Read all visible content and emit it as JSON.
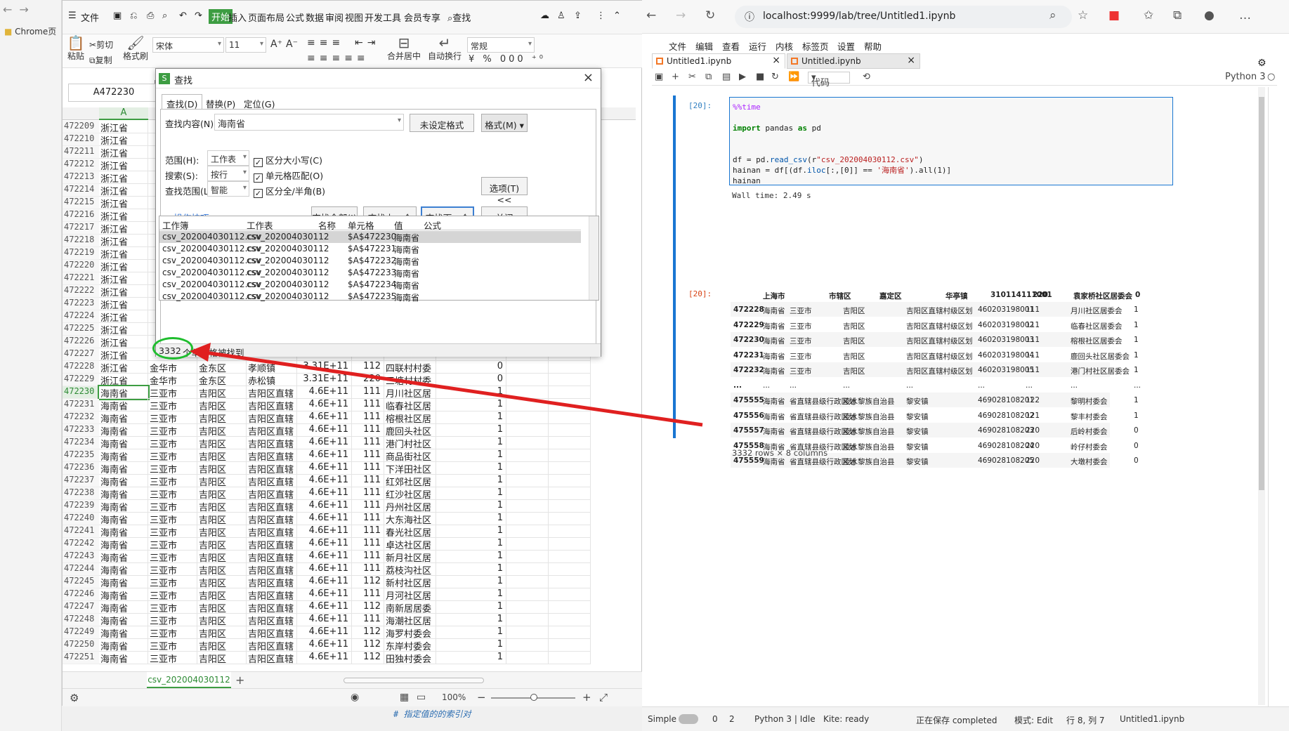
{
  "bg_chrome": {
    "bookmark": "Chrome页"
  },
  "wps": {
    "menu": [
      "文件",
      "开始",
      "插入",
      "页面布局",
      "公式",
      "数据",
      "审阅",
      "视图",
      "开发工具",
      "会员专享"
    ],
    "search": "查找",
    "ribbon": {
      "paste": "粘贴",
      "cut": "剪切",
      "copy": "复制",
      "format_painter": "格式刷",
      "font": "宋体",
      "size": "11",
      "number_format": "常规",
      "merge": "合并居中",
      "wrap": "自动换行"
    },
    "namebox": "A472230",
    "col_a": "A",
    "rows": [
      {
        "n": "472209",
        "a": "浙江省"
      },
      {
        "n": "472210",
        "a": "浙江省"
      },
      {
        "n": "472211",
        "a": "浙江省"
      },
      {
        "n": "472212",
        "a": "浙江省"
      },
      {
        "n": "472213",
        "a": "浙江省"
      },
      {
        "n": "472214",
        "a": "浙江省"
      },
      {
        "n": "472215",
        "a": "浙江省"
      },
      {
        "n": "472216",
        "a": "浙江省"
      },
      {
        "n": "472217",
        "a": "浙江省"
      },
      {
        "n": "472218",
        "a": "浙江省"
      },
      {
        "n": "472219",
        "a": "浙江省"
      },
      {
        "n": "472220",
        "a": "浙江省"
      },
      {
        "n": "472221",
        "a": "浙江省"
      },
      {
        "n": "472222",
        "a": "浙江省"
      },
      {
        "n": "472223",
        "a": "浙江省"
      },
      {
        "n": "472224",
        "a": "浙江省"
      },
      {
        "n": "472225",
        "a": "浙江省"
      },
      {
        "n": "472226",
        "a": "浙江省"
      },
      {
        "n": "472227",
        "a": "浙江省"
      },
      {
        "n": "472228",
        "a": "浙江省",
        "b": "金华市",
        "c": "金东区",
        "d": "孝顺镇",
        "e": "3.31E+11",
        "f": "112",
        "g": "四联村村委",
        "h": "0"
      },
      {
        "n": "472229",
        "a": "浙江省",
        "b": "金华市",
        "c": "金东区",
        "d": "赤松镇",
        "e": "3.31E+11",
        "f": "220",
        "g": "三塘村村委",
        "h": "0"
      },
      {
        "n": "472230",
        "a": "海南省",
        "b": "三亚市",
        "c": "吉阳区",
        "d": "吉阳区直辖",
        "e": "4.6E+11",
        "f": "111",
        "g": "月川社区居",
        "h": "1"
      },
      {
        "n": "472231",
        "a": "海南省",
        "b": "三亚市",
        "c": "吉阳区",
        "d": "吉阳区直辖",
        "e": "4.6E+11",
        "f": "111",
        "g": "临春社区居",
        "h": "1"
      },
      {
        "n": "472232",
        "a": "海南省",
        "b": "三亚市",
        "c": "吉阳区",
        "d": "吉阳区直辖",
        "e": "4.6E+11",
        "f": "111",
        "g": "榕根社区居",
        "h": "1"
      },
      {
        "n": "472233",
        "a": "海南省",
        "b": "三亚市",
        "c": "吉阳区",
        "d": "吉阳区直辖",
        "e": "4.6E+11",
        "f": "111",
        "g": "鹿回头社区",
        "h": "1"
      },
      {
        "n": "472234",
        "a": "海南省",
        "b": "三亚市",
        "c": "吉阳区",
        "d": "吉阳区直辖",
        "e": "4.6E+11",
        "f": "111",
        "g": "港门村社区",
        "h": "1"
      },
      {
        "n": "472235",
        "a": "海南省",
        "b": "三亚市",
        "c": "吉阳区",
        "d": "吉阳区直辖",
        "e": "4.6E+11",
        "f": "111",
        "g": "商品街社区",
        "h": "1"
      },
      {
        "n": "472236",
        "a": "海南省",
        "b": "三亚市",
        "c": "吉阳区",
        "d": "吉阳区直辖",
        "e": "4.6E+11",
        "f": "111",
        "g": "下洋田社区",
        "h": "1"
      },
      {
        "n": "472237",
        "a": "海南省",
        "b": "三亚市",
        "c": "吉阳区",
        "d": "吉阳区直辖",
        "e": "4.6E+11",
        "f": "111",
        "g": "红郊社区居",
        "h": "1"
      },
      {
        "n": "472238",
        "a": "海南省",
        "b": "三亚市",
        "c": "吉阳区",
        "d": "吉阳区直辖",
        "e": "4.6E+11",
        "f": "111",
        "g": "红沙社区居",
        "h": "1"
      },
      {
        "n": "472239",
        "a": "海南省",
        "b": "三亚市",
        "c": "吉阳区",
        "d": "吉阳区直辖",
        "e": "4.6E+11",
        "f": "111",
        "g": "丹州社区居",
        "h": "1"
      },
      {
        "n": "472240",
        "a": "海南省",
        "b": "三亚市",
        "c": "吉阳区",
        "d": "吉阳区直辖",
        "e": "4.6E+11",
        "f": "111",
        "g": "大东海社区",
        "h": "1"
      },
      {
        "n": "472241",
        "a": "海南省",
        "b": "三亚市",
        "c": "吉阳区",
        "d": "吉阳区直辖",
        "e": "4.6E+11",
        "f": "111",
        "g": "春光社区居",
        "h": "1"
      },
      {
        "n": "472242",
        "a": "海南省",
        "b": "三亚市",
        "c": "吉阳区",
        "d": "吉阳区直辖",
        "e": "4.6E+11",
        "f": "111",
        "g": "卓达社区居",
        "h": "1"
      },
      {
        "n": "472243",
        "a": "海南省",
        "b": "三亚市",
        "c": "吉阳区",
        "d": "吉阳区直辖",
        "e": "4.6E+11",
        "f": "111",
        "g": "新月社区居",
        "h": "1"
      },
      {
        "n": "472244",
        "a": "海南省",
        "b": "三亚市",
        "c": "吉阳区",
        "d": "吉阳区直辖",
        "e": "4.6E+11",
        "f": "111",
        "g": "荔枝沟社区",
        "h": "1"
      },
      {
        "n": "472245",
        "a": "海南省",
        "b": "三亚市",
        "c": "吉阳区",
        "d": "吉阳区直辖",
        "e": "4.6E+11",
        "f": "112",
        "g": "新村社区居",
        "h": "1"
      },
      {
        "n": "472246",
        "a": "海南省",
        "b": "三亚市",
        "c": "吉阳区",
        "d": "吉阳区直辖",
        "e": "4.6E+11",
        "f": "111",
        "g": "月河社区居",
        "h": "1"
      },
      {
        "n": "472247",
        "a": "海南省",
        "b": "三亚市",
        "c": "吉阳区",
        "d": "吉阳区直辖",
        "e": "4.6E+11",
        "f": "112",
        "g": "南新居居委",
        "h": "1"
      },
      {
        "n": "472248",
        "a": "海南省",
        "b": "三亚市",
        "c": "吉阳区",
        "d": "吉阳区直辖",
        "e": "4.6E+11",
        "f": "111",
        "g": "海潮社区居",
        "h": "1"
      },
      {
        "n": "472249",
        "a": "海南省",
        "b": "三亚市",
        "c": "吉阳区",
        "d": "吉阳区直辖",
        "e": "4.6E+11",
        "f": "112",
        "g": "海罗村委会",
        "h": "1"
      },
      {
        "n": "472250",
        "a": "海南省",
        "b": "三亚市",
        "c": "吉阳区",
        "d": "吉阳区直辖",
        "e": "4.6E+11",
        "f": "112",
        "g": "东岸村委会",
        "h": "1"
      },
      {
        "n": "472251",
        "a": "海南省",
        "b": "三亚市",
        "c": "吉阳区",
        "d": "吉阳区直辖",
        "e": "4.6E+11",
        "f": "112",
        "g": "田独村委会",
        "h": "1"
      }
    ],
    "sheet_tab": "csv_202004030112",
    "zoom": "100%"
  },
  "find_dialog": {
    "title": "查找",
    "tabs": [
      "查找(D)",
      "替换(P)",
      "定位(G)"
    ],
    "find_label": "查找内容(N):",
    "find_value": "海南省",
    "no_format": "未设定格式",
    "format_btn": "格式(M)",
    "scope_label": "范围(H):",
    "scope_value": "工作表",
    "search_label": "搜索(S):",
    "search_value": "按行",
    "lookin_label": "查找范围(L):",
    "lookin_value": "智能",
    "chk_case": "区分大小写(C)",
    "chk_cell": "单元格匹配(O)",
    "chk_width": "区分全/半角(B)",
    "options_btn": "选项(T) <<",
    "tips": "操作技巧",
    "btn_all": "查找全部(I)",
    "btn_prev": "查找上一个(V)",
    "btn_next": "查找下一个(F)",
    "btn_close": "关闭",
    "columns": [
      "工作簿",
      "工作表",
      "名称",
      "单元格",
      "值",
      "公式"
    ],
    "results": [
      {
        "wb": "csv_202004030112.csv",
        "ws": "csv_202004030112",
        "cell": "$A$472230",
        "val": "海南省"
      },
      {
        "wb": "csv_202004030112.csv",
        "ws": "csv_202004030112",
        "cell": "$A$472231",
        "val": "海南省"
      },
      {
        "wb": "csv_202004030112.csv",
        "ws": "csv_202004030112",
        "cell": "$A$472232",
        "val": "海南省"
      },
      {
        "wb": "csv_202004030112.csv",
        "ws": "csv_202004030112",
        "cell": "$A$472233",
        "val": "海南省"
      },
      {
        "wb": "csv_202004030112.csv",
        "ws": "csv_202004030112",
        "cell": "$A$472234",
        "val": "海南省"
      },
      {
        "wb": "csv_202004030112.csv",
        "ws": "csv_202004030112",
        "cell": "$A$472235",
        "val": "海南省"
      }
    ],
    "status_count": "3332",
    "status_text": "个单元格被找到"
  },
  "edge": {
    "url": "localhost:9999/lab/tree/Untitled1.ipynb",
    "jmenu": [
      "文件",
      "编辑",
      "查看",
      "运行",
      "内核",
      "标签页",
      "设置",
      "帮助"
    ],
    "tabs": [
      "Untitled1.ipynb",
      "Untitled.ipynb"
    ],
    "cell_type": "代码",
    "kernel": "Python 3",
    "in_prompt": "[20]:",
    "out_prompt": "[20]:",
    "code": {
      "l1": "%%time",
      "l2_kw": "import",
      "l2_rest": " pandas ",
      "l2_as": "as",
      "l2_pd": " pd",
      "l3_a": "df = pd.",
      "l3_fn": "read_csv",
      "l3_b": "(r",
      "l3_str": "\"csv_202004030112.csv\"",
      "l3_c": ")",
      "l4_a": "hainan = df[(df.",
      "l4_fn": "iloc",
      "l4_b": "[:,[0]]  == ",
      "l4_str": "'海南省'",
      "l4_c": ").all(1)]",
      "l5": "hainan"
    },
    "walltime": "Wall time: 2.49 s",
    "df_header": [
      "上海市",
      "市辖区",
      "嘉定区",
      "华亭镇",
      "310114111001",
      "220",
      "袁家桥社区居委会",
      "0"
    ],
    "df_rows": [
      [
        "472228",
        "海南省",
        "三亚市",
        "吉阳区",
        "吉阳区直辖村级区划",
        "460203198001",
        "111",
        "月川社区居委会",
        "1"
      ],
      [
        "472229",
        "海南省",
        "三亚市",
        "吉阳区",
        "吉阳区直辖村级区划",
        "460203198002",
        "111",
        "临春社区居委会",
        "1"
      ],
      [
        "472230",
        "海南省",
        "三亚市",
        "吉阳区",
        "吉阳区直辖村级区划",
        "460203198003",
        "111",
        "榕根社区居委会",
        "1"
      ],
      [
        "472231",
        "海南省",
        "三亚市",
        "吉阳区",
        "吉阳区直辖村级区划",
        "460203198004",
        "111",
        "鹿回头社区居委会",
        "1"
      ],
      [
        "472232",
        "海南省",
        "三亚市",
        "吉阳区",
        "吉阳区直辖村级区划",
        "460203198005",
        "111",
        "港门村社区居委会",
        "1"
      ],
      [
        "...",
        "...",
        "...",
        "...",
        "...",
        "...",
        "...",
        "...",
        "..."
      ],
      [
        "475555",
        "海南省",
        "省直辖县级行政区划",
        "陵水黎族自治县",
        "黎安镇",
        "469028108201",
        "122",
        "黎明村委会",
        "1"
      ],
      [
        "475556",
        "海南省",
        "省直辖县级行政区划",
        "陵水黎族自治县",
        "黎安镇",
        "469028108202",
        "121",
        "黎丰村委会",
        "1"
      ],
      [
        "475557",
        "海南省",
        "省直辖县级行政区划",
        "陵水黎族自治县",
        "黎安镇",
        "469028108203",
        "220",
        "后岭村委会",
        "0"
      ],
      [
        "475558",
        "海南省",
        "省直辖县级行政区划",
        "陵水黎族自治县",
        "黎安镇",
        "469028108204",
        "220",
        "岭仔村委会",
        "0"
      ],
      [
        "475559",
        "海南省",
        "省直辖县级行政区划",
        "陵水黎族自治县",
        "黎安镇",
        "469028108205",
        "220",
        "大墩村委会",
        "0"
      ]
    ],
    "shape": "3332 rows × 8 columns",
    "status": {
      "mode": "Simple",
      "n1": "0",
      "n2": "2",
      "kernel": "Python 3 | Idle",
      "kite": "Kite: ready",
      "save": "正在保存 completed",
      "edit": "模式: Edit",
      "pos": "行 8, 列 7",
      "file": "Untitled1.ipynb"
    },
    "bottom_comment": "# 指定值的的索引对"
  },
  "colors": {
    "wps_green": "#3d9d42",
    "jupyter_blue": "#1976d2",
    "annotation_red": "#e02020",
    "annotation_green": "#1fbd2e"
  }
}
